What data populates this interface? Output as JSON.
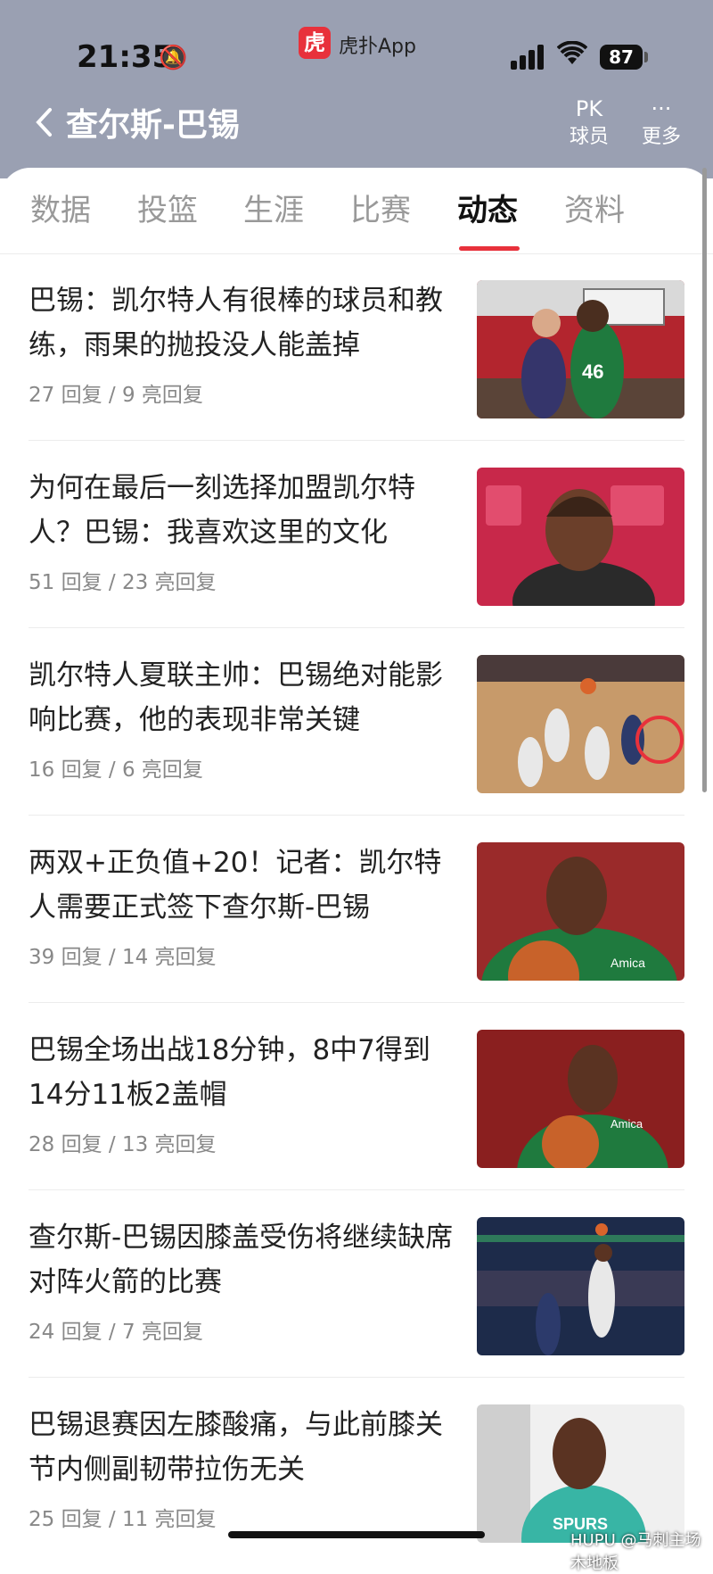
{
  "status_bar": {
    "time": "21:35",
    "app_name": "虎扑App",
    "app_logo_glyph": "虎",
    "battery": "87"
  },
  "header": {
    "back_icon": "chevron-left-icon",
    "title": "查尔斯-巴锡",
    "pk_icon_text": "PK",
    "pk_label": "球员",
    "more_icon_text": "···",
    "more_label": "更多"
  },
  "tabs": [
    {
      "label": "数据"
    },
    {
      "label": "投篮"
    },
    {
      "label": "生涯"
    },
    {
      "label": "比赛"
    },
    {
      "label": "动态",
      "active": true
    },
    {
      "label": "资料"
    }
  ],
  "feed": [
    {
      "headline": "巴锡：凯尔特人有很棒的球员和教练，雨果的抛投没人能盖掉",
      "meta": "27 回复 / 9 亮回复",
      "thumb_desc": "dunk-photo"
    },
    {
      "headline": "为何在最后一刻选择加盟凯尔特人？巴锡：我喜欢这里的文化",
      "meta": "51 回复 / 23 亮回复",
      "thumb_desc": "summer-league-interview-photo"
    },
    {
      "headline": "凯尔特人夏联主帅：巴锡绝对能影响比赛，他的表现非常关键",
      "meta": "16 回复 / 6 亮回复",
      "thumb_desc": "rebound-photo"
    },
    {
      "headline": "两双+正负值+20！记者：凯尔特人需要正式签下查尔斯-巴锡",
      "meta": "39 回复 / 14 亮回复",
      "thumb_desc": "portrait-photo"
    },
    {
      "headline": "巴锡全场出战18分钟，8中7得到14分11板2盖帽",
      "meta": "28 回复 / 13 亮回复",
      "thumb_desc": "holding-ball-photo"
    },
    {
      "headline": "查尔斯-巴锡因膝盖受伤将继续缺席对阵火箭的比赛",
      "meta": "24 回复 / 7 亮回复",
      "thumb_desc": "shot-block-photo"
    },
    {
      "headline": "巴锡退赛因左膝酸痛，与此前膝关节内侧副韧带拉伤无关",
      "meta": "25 回复 / 11 亮回复",
      "thumb_desc": "spurs-player-photo",
      "thumb_text": "SPURS"
    }
  ],
  "watermark": "@马刺主场木地板",
  "watermark_logo": "HUPU",
  "colors": {
    "header_bg": "#9aa0b2",
    "accent": "#e8313b",
    "celtics_green": "#1f7a3e"
  }
}
